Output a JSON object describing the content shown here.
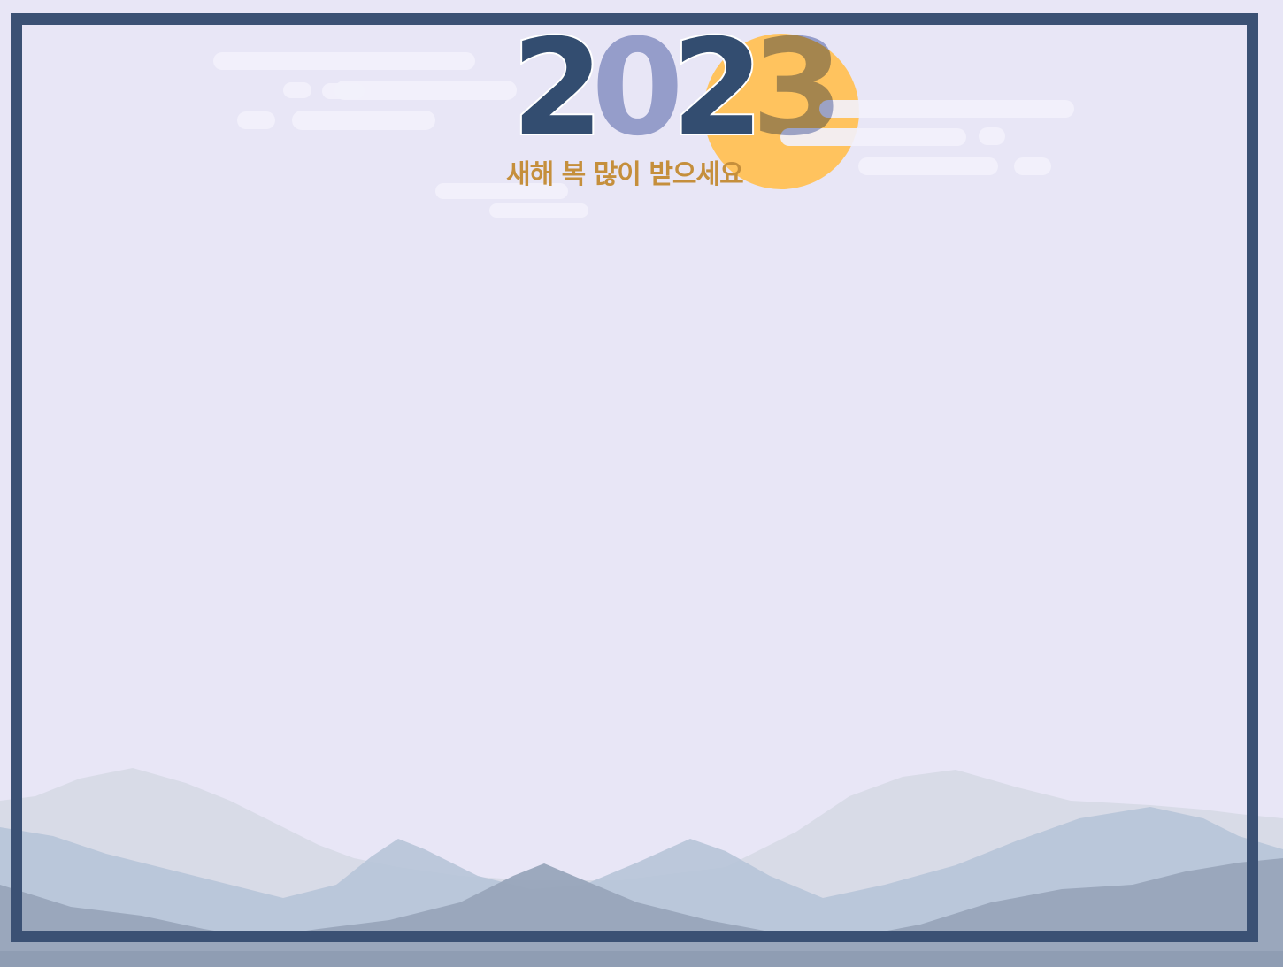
{
  "card": {
    "year_digits": [
      "2",
      "0",
      "2",
      "3"
    ],
    "greeting": "새해 복 많이 받으세요"
  },
  "colors": {
    "background": "#e8e6f6",
    "frame": "#3b5174",
    "sun": "#ffc35e",
    "year_dark": "#334d70",
    "year_light": "#a4aed2",
    "greeting": "#c58f3c",
    "mountain_far": "#d6d9e6",
    "mountain_mid": "#b7c4d8",
    "mountain_near": "#98a5bb"
  }
}
